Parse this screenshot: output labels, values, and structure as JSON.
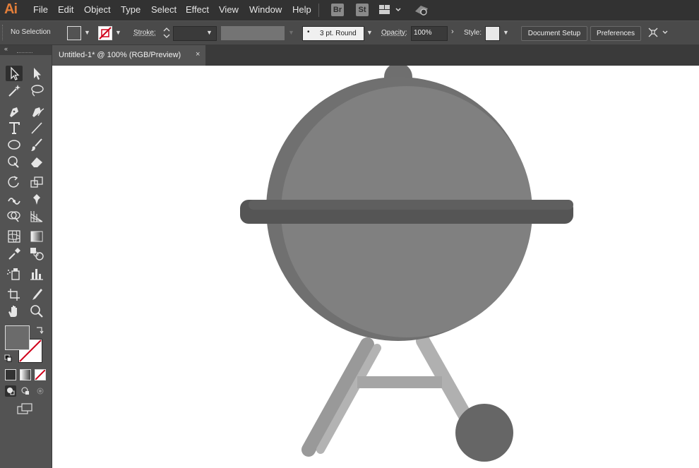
{
  "app": {
    "logo": "Ai"
  },
  "menu": [
    "File",
    "Edit",
    "Object",
    "Type",
    "Select",
    "Effect",
    "View",
    "Window",
    "Help"
  ],
  "bridge_icons": {
    "br": "Br",
    "st": "St"
  },
  "control_bar": {
    "selection": "No Selection",
    "stroke_label": "Stroke:",
    "brush": "3 pt. Round",
    "opacity_label": "Opacity:",
    "opacity_value": "100%",
    "style_label": "Style:",
    "document_setup": "Document Setup",
    "preferences": "Preferences"
  },
  "document_tab": {
    "title": "Untitled-1* @ 100% (RGB/Preview)",
    "close": "×"
  },
  "icons": [
    "selection-tool-icon",
    "direct-selection-tool-icon",
    "magic-wand-icon",
    "lasso-icon",
    "pen-tool-icon",
    "curvature-tool-icon",
    "type-tool-icon",
    "line-tool-icon",
    "ellipse-tool-icon",
    "paintbrush-icon",
    "shaper-tool-icon",
    "eraser-icon",
    "rotate-tool-icon",
    "scale-tool-icon",
    "width-tool-icon",
    "puppet-warp-icon",
    "shape-builder-icon",
    "perspective-grid-icon",
    "mesh-tool-icon",
    "gradient-tool-icon",
    "eyedropper-icon",
    "blend-tool-icon",
    "symbol-sprayer-icon",
    "column-graph-icon",
    "artboard-tool-icon",
    "slice-tool-icon",
    "hand-tool-icon",
    "zoom-tool-icon"
  ],
  "colors": {
    "fill": "#6b6b6b",
    "stroke": "none",
    "canvas": "#ffffff",
    "app_bg": "#535353",
    "accent": "#e27e3a"
  }
}
